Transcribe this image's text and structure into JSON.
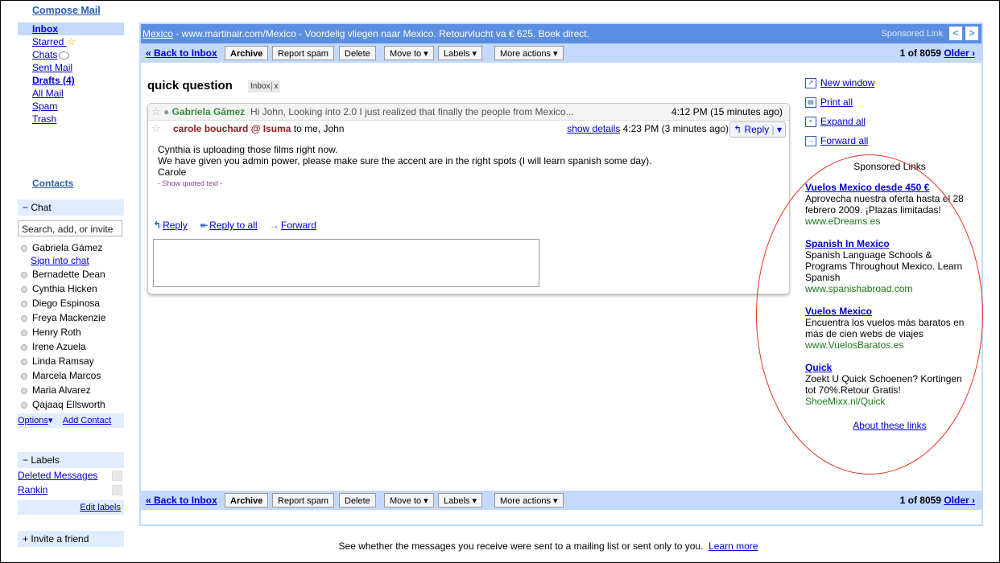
{
  "nav": {
    "compose": "Compose Mail",
    "items": [
      {
        "label": "Inbox"
      },
      {
        "label": "Starred"
      },
      {
        "label": "Chats"
      },
      {
        "label": "Sent Mail"
      },
      {
        "label": "Drafts (4)"
      },
      {
        "label": "All Mail"
      },
      {
        "label": "Spam"
      },
      {
        "label": "Trash"
      }
    ],
    "contacts": "Contacts"
  },
  "chat": {
    "header": "Chat",
    "search_value": "Search, add, or invite",
    "me": "Gabriela Gámez",
    "sign_in": "Sign into chat",
    "contacts": [
      "Bernadette Dean",
      "Cynthia Hicken",
      "Diego Espinosa",
      "Freya Mackenzie",
      "Henry Roth",
      "Irene Azuela",
      "Linda Ramsay",
      "Marcela Marcos",
      "Maria Alvarez",
      "Qajaaq Ellsworth"
    ],
    "options": "Options",
    "add_contact": "Add Contact"
  },
  "labels": {
    "header": "Labels",
    "items": [
      "Deleted Messages",
      "Rankin"
    ],
    "edit": "Edit labels"
  },
  "invite": "Invite a friend",
  "adbar": {
    "link": "Mexico",
    "text": " - www.martinair.com/Mexico - Voordelig vliegen naar Mexico. Retourvlucht va € 625. Boek direct.",
    "sponsored": "Sponsored Link",
    "prev": "<",
    "next": ">"
  },
  "toolbar": {
    "back": "« Back to Inbox",
    "archive": "Archive",
    "spam": "Report spam",
    "delete": "Delete",
    "move": "Move to ▾",
    "labels": "Labels ▾",
    "more": "More actions ▾",
    "count": "1 of 8059",
    "older": "Older ›"
  },
  "thread": {
    "subject": "quick question",
    "tag": "Inbox",
    "tag_close": "x",
    "msg1": {
      "sender": "Gabriela Gámez",
      "snippet": "Hi John, Looking into 2.0 I just realized that finally the people from Mexico...",
      "time": "4:12 PM (15 minutes ago)"
    },
    "msg2": {
      "sender": "carole bouchard @ Isuma",
      "to": "to me, John",
      "details": "show details",
      "time": "4:23 PM (3 minutes ago)",
      "reply": "Reply",
      "body1": "Cynthia is uploading those films right now.",
      "body2": "We have given you admin power, please make sure the accent are in the right spots (I will learn spanish some day).",
      "body3": "Carole",
      "quoted": "- Show quoted text -"
    },
    "actions": {
      "reply": "Reply",
      "reply_all": "Reply to all",
      "forward": "Forward"
    }
  },
  "side_links": [
    "New window",
    "Print all",
    "Expand all",
    "Forward all"
  ],
  "ads": {
    "header": "Sponsored Links",
    "items": [
      {
        "title": "Vuelos Mexico desde 450 €",
        "text": "Aprovecha nuestra oferta hasta el 28 febrero 2009. ¡Plazas limitadas!",
        "url": "www.eDreams.es"
      },
      {
        "title": "Spanish In Mexico",
        "text": "Spanish Language Schools & Programs Throughout Mexico. Learn Spanish",
        "url": "www.spanishabroad.com"
      },
      {
        "title": "Vuelos Mexico",
        "text": "Encuentra los vuelos más baratos en más de cien webs de viajes",
        "url": "www.VuelosBaratos.es"
      },
      {
        "title": "Quick",
        "text": "Zoekt U Quick Schoenen? Kortingen tot 70%.Retour Gratis!",
        "url": "ShoeMixx.nl/Quick"
      }
    ],
    "about": "About these links"
  },
  "footer": {
    "text": "See whether the messages you receive were sent to a mailing list or sent only to you.",
    "learn": "Learn more"
  }
}
